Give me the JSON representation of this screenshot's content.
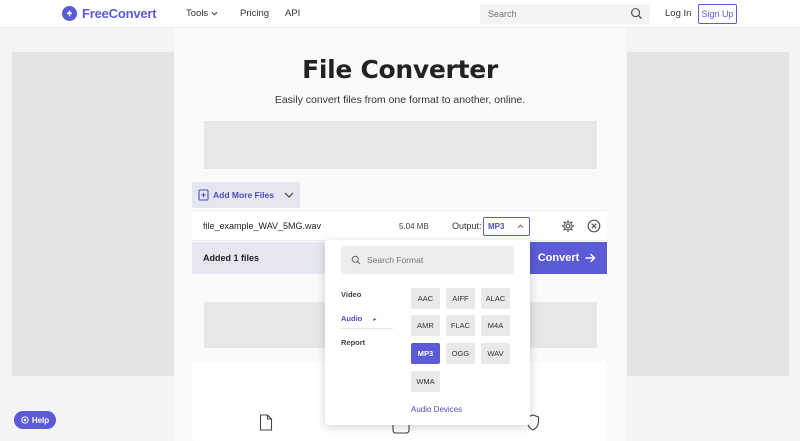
{
  "header": {
    "logo_text": "FreeConvert",
    "nav": {
      "tools": "Tools",
      "pricing": "Pricing",
      "api": "API"
    },
    "search_placeholder": "Search",
    "login": "Log In",
    "signup": "Sign Up"
  },
  "hero": {
    "title": "File Converter",
    "subtitle": "Easily convert files from one format to another, online."
  },
  "uploader": {
    "add_more_label": "Add More Files",
    "file": {
      "name": "file_example_WAV_5MG.wav",
      "size": "5.04 MB",
      "output_label": "Output:",
      "output_value": "MP3"
    },
    "added_text": "Added 1 files",
    "convert_label": "Convert"
  },
  "format_dropdown": {
    "search_placeholder": "Search Format",
    "categories": [
      {
        "label": "Video",
        "active": false
      },
      {
        "label": "Audio",
        "active": true
      },
      {
        "label": "Report",
        "active": false
      }
    ],
    "formats": [
      "AAC",
      "AIFF",
      "ALAC",
      "AMR",
      "FLAC",
      "M4A",
      "MP3",
      "OGG",
      "WAV",
      "WMA"
    ],
    "selected": "MP3",
    "audio_devices": "Audio Devices"
  },
  "help_label": "Help",
  "colors": {
    "accent": "#5b5bd6"
  }
}
